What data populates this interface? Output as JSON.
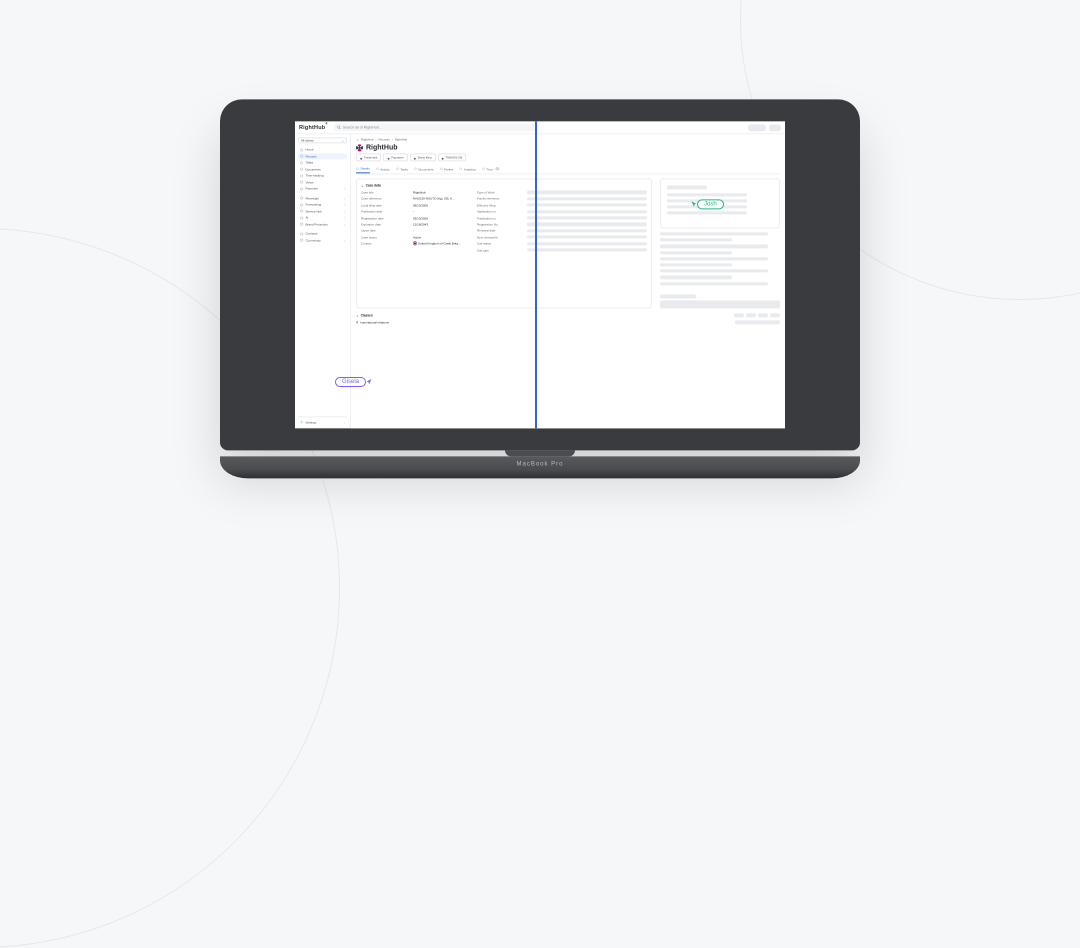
{
  "brand": "RightHub",
  "search": {
    "placeholder": "Search all of RightHub..."
  },
  "client_selector": "All clients",
  "sidebar": {
    "primary": [
      {
        "label": "Home"
      },
      {
        "label": "Records"
      },
      {
        "label": "Tasks"
      },
      {
        "label": "Documents"
      },
      {
        "label": "Time-tracking"
      },
      {
        "label": "Views"
      },
      {
        "label": "Favorites"
      }
    ],
    "secondary": [
      {
        "label": "Renewals"
      },
      {
        "label": "Forecasting"
      },
      {
        "label": "Service Hub"
      },
      {
        "label": "AI"
      },
      {
        "label": "Brand Protection"
      }
    ],
    "tertiary": [
      {
        "label": "Contacts"
      },
      {
        "label": "Community"
      }
    ],
    "settings": "Settings"
  },
  "breadcrumbs": [
    "RightHub",
    "Records",
    "RightHub"
  ],
  "page": {
    "title": "RightHub",
    "chips": [
      {
        "label": "Trademark"
      },
      {
        "label": "Figurative"
      },
      {
        "label": "Direct filing"
      },
      {
        "label": "TM00031-GB"
      }
    ],
    "tabs": [
      {
        "label": "Details"
      },
      {
        "label": "Activity"
      },
      {
        "label": "Tasks"
      },
      {
        "label": "Documents"
      },
      {
        "label": "Parties"
      },
      {
        "label": "Analytics"
      },
      {
        "label": "Time",
        "badge": "23"
      }
    ]
  },
  "case_data": {
    "section_title": "Case data",
    "fields_left": [
      {
        "label": "Case title",
        "value": "RightHub"
      },
      {
        "label": "Case reference",
        "value": "M-00130-NUUTO (fig), GB, K..."
      },
      {
        "label": "Local filing date",
        "value": "09/13/2005"
      },
      {
        "label": "Publication date",
        "value": "-"
      },
      {
        "label": "Registration date",
        "value": "09/13/2005"
      },
      {
        "label": "Expiration date",
        "value": "12/18/2043"
      },
      {
        "label": "Lapse date",
        "value": "-"
      },
      {
        "label": "Case status",
        "value": "Active"
      },
      {
        "label": "Country",
        "value": "United Kingdom of Great Brita..."
      }
    ],
    "fields_right": [
      "Type of Work",
      "Family reference",
      "Effective filing",
      "Application no",
      "Publication no",
      "Registration No",
      "Renewal date",
      "Next renewal fe",
      "Sub status",
      "Sub type"
    ]
  },
  "classes": {
    "title": "Classes",
    "subtitle": "International relations"
  },
  "cursors": {
    "josh": "Josh",
    "gisela": "Gisela"
  },
  "device_label": "MacBook Pro"
}
